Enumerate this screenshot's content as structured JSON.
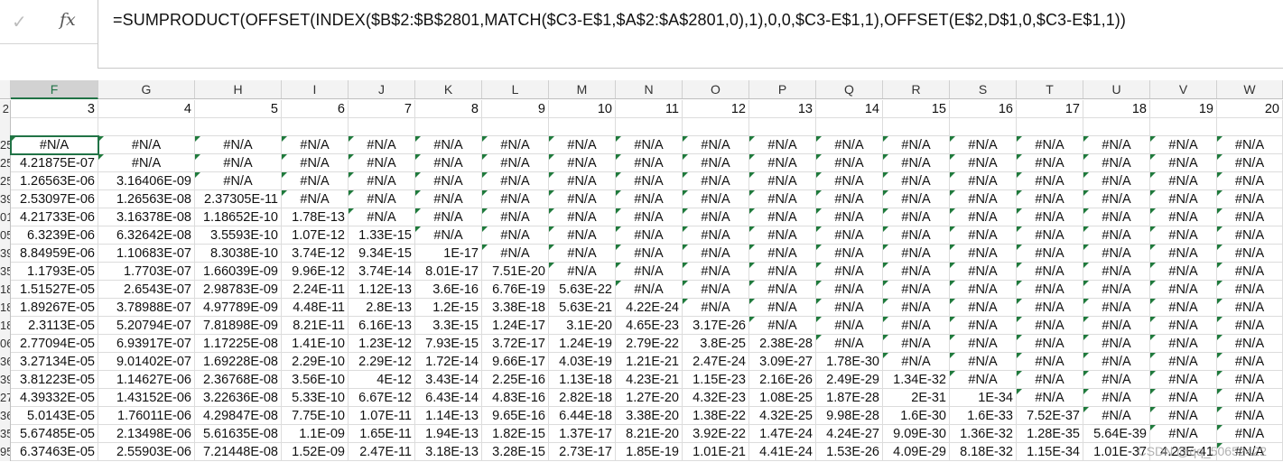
{
  "formula_bar": {
    "cancel_icon": "check-icon",
    "fx_label": "fx",
    "formula": "=SUMPRODUCT(OFFSET(INDEX($B$2:$B$2801,MATCH($C3-E$1,$A$2:$A$2801,0),1),0,0,$C3-E$1,1),OFFSET(E$2,D$1,0,$C3-E$1,1))"
  },
  "selected_column": "F",
  "columns": [
    "F",
    "G",
    "H",
    "I",
    "J",
    "K",
    "L",
    "M",
    "N",
    "O",
    "P",
    "Q",
    "R",
    "S",
    "T",
    "U",
    "V",
    "W"
  ],
  "row_stubs": [
    "2",
    "",
    "25",
    "25",
    "25",
    "39",
    "01",
    "05",
    "39",
    "35",
    "18",
    "18",
    "18",
    "06",
    "36",
    "39",
    "27",
    "36",
    "35",
    "95"
  ],
  "header_row": [
    "3",
    "4",
    "5",
    "6",
    "7",
    "8",
    "9",
    "10",
    "11",
    "12",
    "13",
    "14",
    "15",
    "16",
    "17",
    "18",
    "19",
    "20"
  ],
  "rows": [
    [
      "#N/A",
      "#N/A",
      "#N/A",
      "#N/A",
      "#N/A",
      "#N/A",
      "#N/A",
      "#N/A",
      "#N/A",
      "#N/A",
      "#N/A",
      "#N/A",
      "#N/A",
      "#N/A",
      "#N/A",
      "#N/A",
      "#N/A",
      "#N/A"
    ],
    [
      "4.21875E-07",
      "#N/A",
      "#N/A",
      "#N/A",
      "#N/A",
      "#N/A",
      "#N/A",
      "#N/A",
      "#N/A",
      "#N/A",
      "#N/A",
      "#N/A",
      "#N/A",
      "#N/A",
      "#N/A",
      "#N/A",
      "#N/A",
      "#N/A"
    ],
    [
      "1.26563E-06",
      "3.16406E-09",
      "#N/A",
      "#N/A",
      "#N/A",
      "#N/A",
      "#N/A",
      "#N/A",
      "#N/A",
      "#N/A",
      "#N/A",
      "#N/A",
      "#N/A",
      "#N/A",
      "#N/A",
      "#N/A",
      "#N/A",
      "#N/A"
    ],
    [
      "2.53097E-06",
      "1.26563E-08",
      "2.37305E-11",
      "#N/A",
      "#N/A",
      "#N/A",
      "#N/A",
      "#N/A",
      "#N/A",
      "#N/A",
      "#N/A",
      "#N/A",
      "#N/A",
      "#N/A",
      "#N/A",
      "#N/A",
      "#N/A",
      "#N/A"
    ],
    [
      "4.21733E-06",
      "3.16378E-08",
      "1.18652E-10",
      "1.78E-13",
      "#N/A",
      "#N/A",
      "#N/A",
      "#N/A",
      "#N/A",
      "#N/A",
      "#N/A",
      "#N/A",
      "#N/A",
      "#N/A",
      "#N/A",
      "#N/A",
      "#N/A",
      "#N/A"
    ],
    [
      "6.3239E-06",
      "6.32642E-08",
      "3.5593E-10",
      "1.07E-12",
      "1.33E-15",
      "#N/A",
      "#N/A",
      "#N/A",
      "#N/A",
      "#N/A",
      "#N/A",
      "#N/A",
      "#N/A",
      "#N/A",
      "#N/A",
      "#N/A",
      "#N/A",
      "#N/A"
    ],
    [
      "8.84959E-06",
      "1.10683E-07",
      "8.3038E-10",
      "3.74E-12",
      "9.34E-15",
      "1E-17",
      "#N/A",
      "#N/A",
      "#N/A",
      "#N/A",
      "#N/A",
      "#N/A",
      "#N/A",
      "#N/A",
      "#N/A",
      "#N/A",
      "#N/A",
      "#N/A"
    ],
    [
      "1.1793E-05",
      "1.7703E-07",
      "1.66039E-09",
      "9.96E-12",
      "3.74E-14",
      "8.01E-17",
      "7.51E-20",
      "#N/A",
      "#N/A",
      "#N/A",
      "#N/A",
      "#N/A",
      "#N/A",
      "#N/A",
      "#N/A",
      "#N/A",
      "#N/A",
      "#N/A"
    ],
    [
      "1.51527E-05",
      "2.6543E-07",
      "2.98783E-09",
      "2.24E-11",
      "1.12E-13",
      "3.6E-16",
      "6.76E-19",
      "5.63E-22",
      "#N/A",
      "#N/A",
      "#N/A",
      "#N/A",
      "#N/A",
      "#N/A",
      "#N/A",
      "#N/A",
      "#N/A",
      "#N/A"
    ],
    [
      "1.89267E-05",
      "3.78988E-07",
      "4.97789E-09",
      "4.48E-11",
      "2.8E-13",
      "1.2E-15",
      "3.38E-18",
      "5.63E-21",
      "4.22E-24",
      "#N/A",
      "#N/A",
      "#N/A",
      "#N/A",
      "#N/A",
      "#N/A",
      "#N/A",
      "#N/A",
      "#N/A"
    ],
    [
      "2.3113E-05",
      "5.20794E-07",
      "7.81898E-09",
      "8.21E-11",
      "6.16E-13",
      "3.3E-15",
      "1.24E-17",
      "3.1E-20",
      "4.65E-23",
      "3.17E-26",
      "#N/A",
      "#N/A",
      "#N/A",
      "#N/A",
      "#N/A",
      "#N/A",
      "#N/A",
      "#N/A"
    ],
    [
      "2.77094E-05",
      "6.93917E-07",
      "1.17225E-08",
      "1.41E-10",
      "1.23E-12",
      "7.93E-15",
      "3.72E-17",
      "1.24E-19",
      "2.79E-22",
      "3.8E-25",
      "2.38E-28",
      "#N/A",
      "#N/A",
      "#N/A",
      "#N/A",
      "#N/A",
      "#N/A",
      "#N/A"
    ],
    [
      "3.27134E-05",
      "9.01402E-07",
      "1.69228E-08",
      "2.29E-10",
      "2.29E-12",
      "1.72E-14",
      "9.66E-17",
      "4.03E-19",
      "1.21E-21",
      "2.47E-24",
      "3.09E-27",
      "1.78E-30",
      "#N/A",
      "#N/A",
      "#N/A",
      "#N/A",
      "#N/A",
      "#N/A"
    ],
    [
      "3.81223E-05",
      "1.14627E-06",
      "2.36768E-08",
      "3.56E-10",
      "4E-12",
      "3.43E-14",
      "2.25E-16",
      "1.13E-18",
      "4.23E-21",
      "1.15E-23",
      "2.16E-26",
      "2.49E-29",
      "1.34E-32",
      "#N/A",
      "#N/A",
      "#N/A",
      "#N/A",
      "#N/A"
    ],
    [
      "4.39332E-05",
      "1.43152E-06",
      "3.22636E-08",
      "5.33E-10",
      "6.67E-12",
      "6.43E-14",
      "4.83E-16",
      "2.82E-18",
      "1.27E-20",
      "4.32E-23",
      "1.08E-25",
      "1.87E-28",
      "2E-31",
      "1E-34",
      "#N/A",
      "#N/A",
      "#N/A",
      "#N/A"
    ],
    [
      "5.0143E-05",
      "1.76011E-06",
      "4.29847E-08",
      "7.75E-10",
      "1.07E-11",
      "1.14E-13",
      "9.65E-16",
      "6.44E-18",
      "3.38E-20",
      "1.38E-22",
      "4.32E-25",
      "9.98E-28",
      "1.6E-30",
      "1.6E-33",
      "7.52E-37",
      "#N/A",
      "#N/A",
      "#N/A"
    ],
    [
      "5.67485E-05",
      "2.13498E-06",
      "5.61635E-08",
      "1.1E-09",
      "1.65E-11",
      "1.94E-13",
      "1.82E-15",
      "1.37E-17",
      "8.21E-20",
      "3.92E-22",
      "1.47E-24",
      "4.24E-27",
      "9.09E-30",
      "1.36E-32",
      "1.28E-35",
      "5.64E-39",
      "#N/A",
      "#N/A"
    ],
    [
      "6.37463E-05",
      "2.55903E-06",
      "7.21448E-08",
      "1.52E-09",
      "2.47E-11",
      "3.18E-13",
      "3.28E-15",
      "2.73E-17",
      "1.85E-19",
      "1.01E-21",
      "4.41E-24",
      "1.53E-26",
      "4.09E-29",
      "8.18E-32",
      "1.15E-34",
      "1.01E-37",
      "4.23E-41",
      "#N/A"
    ]
  ],
  "watermark": "CSDN @qq_50652422"
}
